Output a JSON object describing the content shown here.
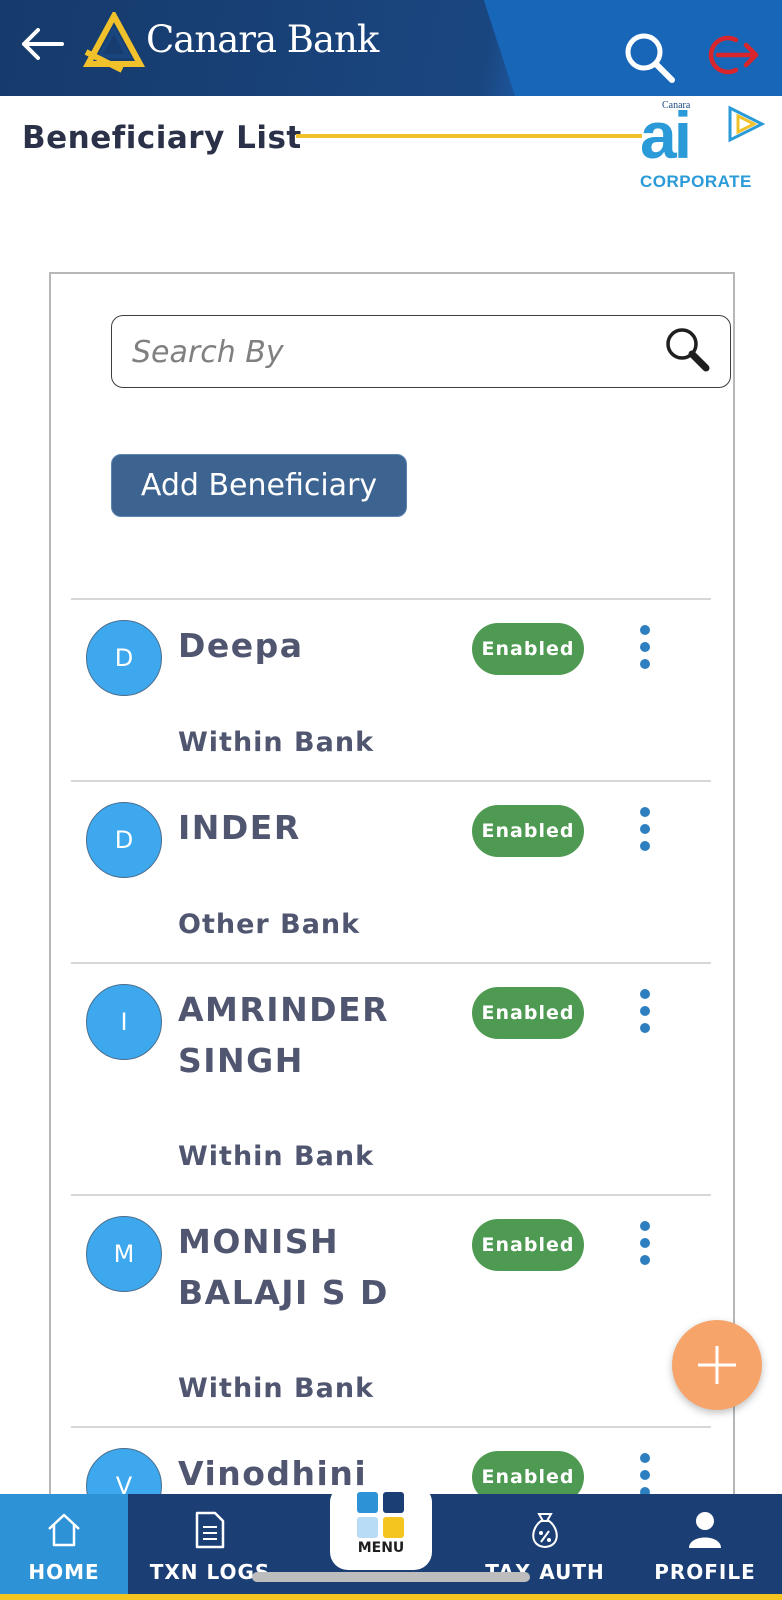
{
  "header": {
    "brand_name": "Canara Bank"
  },
  "page": {
    "title": "Beneficiary List",
    "ai_logo_text": "ai",
    "ai_logo_subtext": "CORPORATE",
    "ai_logo_mini": "Canara"
  },
  "search": {
    "placeholder": "Search By"
  },
  "actions": {
    "add_beneficiary_label": "Add Beneficiary"
  },
  "beneficiaries": [
    {
      "initial": "D",
      "name": "Deepa",
      "status": "Enabled",
      "type": "Within Bank"
    },
    {
      "initial": "D",
      "name": "INDER",
      "status": "Enabled",
      "type": "Other Bank"
    },
    {
      "initial": "I",
      "name": "AMRINDER SINGH",
      "status": "Enabled",
      "type": "Within Bank"
    },
    {
      "initial": "M",
      "name": "MONISH BALAJI S D",
      "status": "Enabled",
      "type": "Within Bank"
    },
    {
      "initial": "V",
      "name": "Vinodhini",
      "status": "Enabled",
      "type": ""
    }
  ],
  "bottom_nav": {
    "items": [
      {
        "label": "HOME",
        "icon": "home-icon"
      },
      {
        "label": "TXN LOGS",
        "icon": "document-icon"
      },
      {
        "label": "MENU",
        "icon": "grid-icon"
      },
      {
        "label": "TAX AUTH",
        "icon": "money-bag-icon"
      },
      {
        "label": "PROFILE",
        "icon": "user-icon"
      }
    ]
  },
  "colors": {
    "header": "#1a4680",
    "accent_yellow": "#f1c12b",
    "avatar": "#3ea8ee",
    "badge_enabled": "#4f9a52",
    "button": "#3d6491",
    "fab": "#f7a46b",
    "logout": "#d9262c"
  }
}
